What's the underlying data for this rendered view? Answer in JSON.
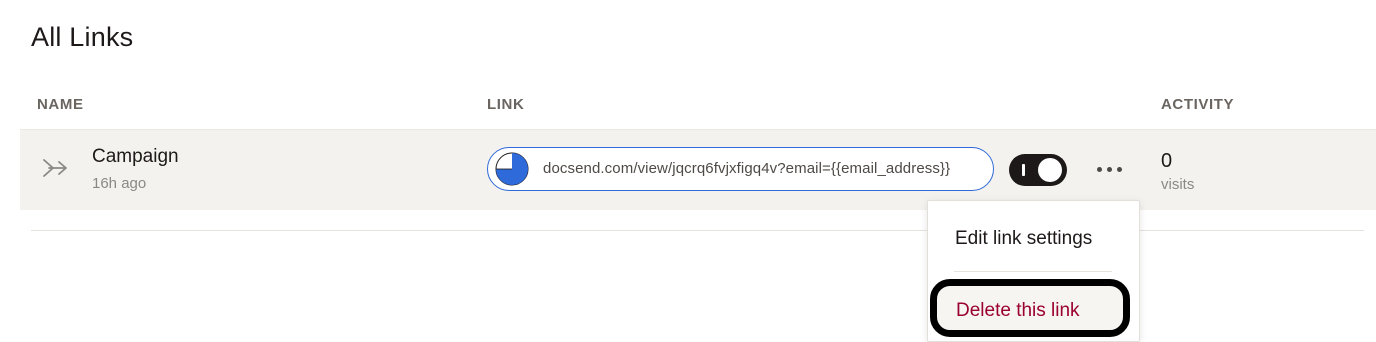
{
  "page": {
    "title": "All Links"
  },
  "table": {
    "headers": {
      "name": "NAME",
      "link": "LINK",
      "activity": "ACTIVITY"
    },
    "rows": [
      {
        "icon": "forward-arrow-icon",
        "name": "Campaign",
        "time": "16h ago",
        "url": "docsend.com/view/jqcrq6fvjxfigq4v?email={{email_address}}",
        "link_icon": "pie-chart-icon",
        "enabled": true,
        "visits": "0",
        "visits_label": "visits"
      }
    ]
  },
  "menu": {
    "items": [
      {
        "label": "Edit link settings"
      },
      {
        "label": "Delete this link",
        "color": "#9b0032"
      }
    ]
  },
  "colors": {
    "accent": "#2e6ad9",
    "danger": "#9b0032",
    "row_bg": "#f4f2ef"
  }
}
